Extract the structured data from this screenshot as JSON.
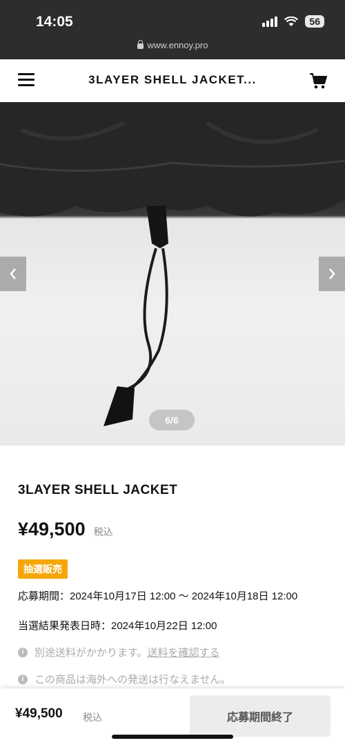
{
  "status_bar": {
    "time": "14:05",
    "battery": "56"
  },
  "browser": {
    "url": "www.ennoy.pro"
  },
  "header": {
    "title": "3LAYER SHELL JACKET..."
  },
  "gallery": {
    "counter": "6/6",
    "prev_icon": "chevron-left-icon",
    "next_icon": "chevron-right-icon"
  },
  "product": {
    "name": "3LAYER SHELL JACKET",
    "price": "¥49,500",
    "tax_label": "税込",
    "badge": "抽選販売",
    "application_period": "応募期間：2024年10月17日 12:00 〜 2024年10月18日 12:00",
    "result_date": "当選結果発表日時：2024年10月22日 12:00",
    "shipping_note": "別途送料がかかります。",
    "shipping_link": "送料を確認する",
    "overseas_note": "この商品は海外への発送は行なえません。"
  },
  "footer": {
    "price": "¥49,500",
    "tax_label": "税込",
    "button_label": "応募期間終了"
  },
  "colors": {
    "badge": "#f5a70a",
    "status_bar": "#2b2d2f",
    "button_bg": "#ececec"
  }
}
